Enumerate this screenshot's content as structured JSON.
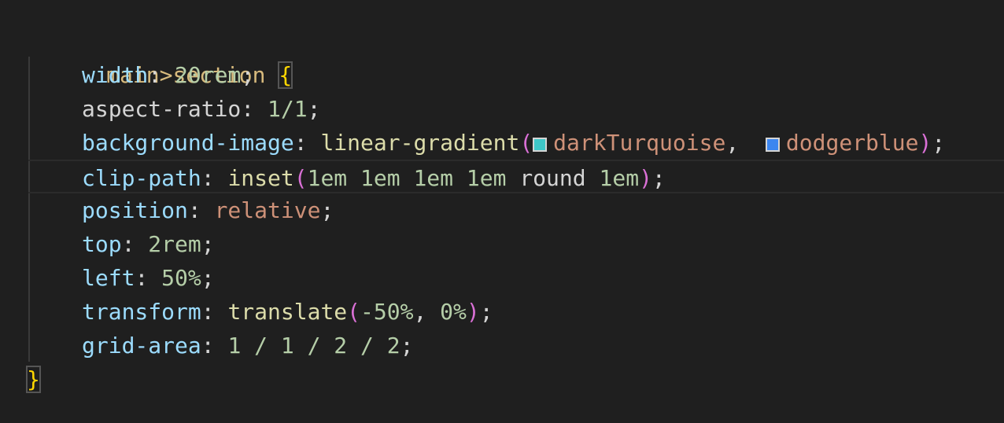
{
  "code": {
    "selector": "main>section",
    "open_brace": "{",
    "close_brace": "}",
    "lines": [
      {
        "prop": "width",
        "colon": ": ",
        "value": "20rem",
        "semi": ";"
      },
      {
        "prop": "aspect-ratio",
        "colon": ": ",
        "value": "1/1",
        "semi": ";"
      },
      {
        "prop": "background-image",
        "colon": ": ",
        "fn": "linear-gradient",
        "open": "(",
        "color1": "darkTurquoise",
        "swatch1": "#00ced1",
        "sep": ", ",
        "color2": "dodgerblue",
        "swatch2": "#1e90ff",
        "close": ")",
        "semi": ";"
      },
      {
        "prop": "clip-path",
        "colon": ": ",
        "fn": "inset",
        "open": "(",
        "v1": "1em 1em 1em 1em",
        "kw": " round ",
        "v2": "1em",
        "close": ")",
        "semi": ";"
      },
      {
        "prop": "position",
        "colon": ": ",
        "value": "relative",
        "semi": ";"
      },
      {
        "prop": "top",
        "colon": ": ",
        "value": "2rem",
        "semi": ";"
      },
      {
        "prop": "left",
        "colon": ": ",
        "value": "50%",
        "semi": ";"
      },
      {
        "prop": "transform",
        "colon": ": ",
        "fn": "translate",
        "open": "(",
        "v1": "-50%",
        "sep": ", ",
        "v2": "0%",
        "close": ")",
        "semi": ";"
      },
      {
        "prop": "grid-area",
        "colon": ": ",
        "value": "1 / 1 / 2 / 2",
        "semi": ";"
      }
    ]
  },
  "colors": {
    "background": "#1f1f1f",
    "property": "#9cdcfe",
    "selector": "#d7ba7d",
    "function": "#dcdcaa",
    "number": "#b5cea8",
    "string": "#ce9178",
    "bracket": "#ffd700",
    "paren": "#da70d6"
  }
}
